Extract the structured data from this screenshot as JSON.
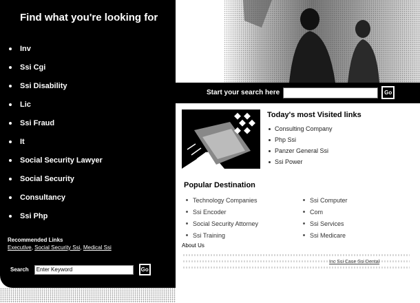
{
  "sidebar": {
    "heading": "Find what you're looking for",
    "items": [
      "Inv",
      "Ssi Cgi",
      "Ssi Disability",
      "Lic",
      "Ssi Fraud",
      "It",
      "Social Security Lawyer",
      "Social Security",
      "Consultancy",
      "Ssi Php"
    ],
    "recommended": {
      "title": "Recommended Links",
      "links": [
        "Executive",
        "Social Security Ssi",
        "Medical Ssi"
      ]
    },
    "search": {
      "label": "Search",
      "placeholder": "Enter Keyword",
      "button": "Go"
    }
  },
  "hero": {
    "search_label": "Start your search here",
    "search_value": "",
    "button": "Go"
  },
  "visited": {
    "title": "Today's most Visited links",
    "links": [
      "Consulting Company",
      "Php Ssi",
      "Panzer General Ssi",
      "Ssi Power"
    ]
  },
  "popular": {
    "title": "Popular Destination",
    "left": [
      "Technology Companies",
      "Ssi Encoder",
      "Social Security Attorney",
      "Ssi Training"
    ],
    "right": [
      "Ssi Computer",
      "Com",
      "Ssi Services",
      "Ssi Medicare"
    ]
  },
  "about": {
    "title": "About Us",
    "links": "Inc  Ssi Case  Ssi Dental"
  },
  "colors": {
    "sidebar_bg": "#000000",
    "text_light": "#ffffff",
    "page_bg": "#ffffff"
  }
}
